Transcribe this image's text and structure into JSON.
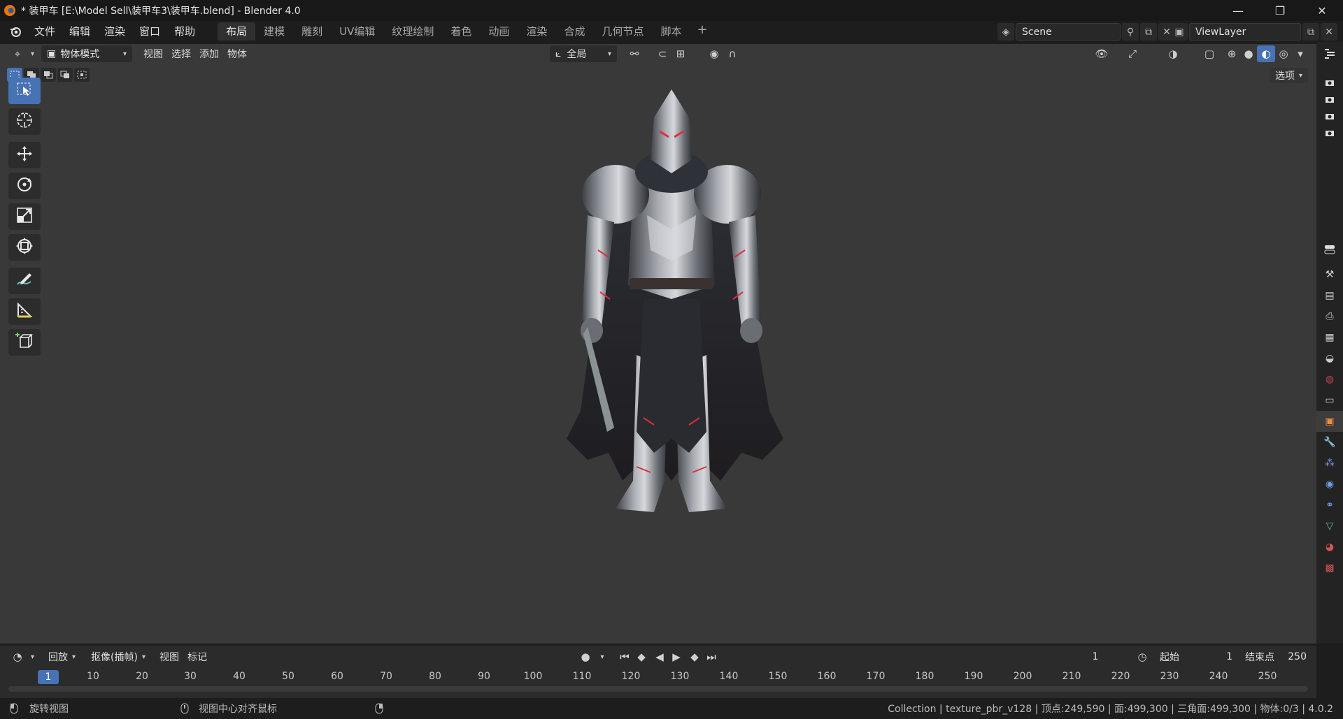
{
  "window": {
    "title": "* 装甲车 [E:\\Model Sell\\装甲车3\\装甲车.blend] - Blender 4.0",
    "minimize": "—",
    "maximize": "❐",
    "close": "✕"
  },
  "menubar": {
    "menus": [
      "文件",
      "编辑",
      "渲染",
      "窗口",
      "帮助"
    ],
    "workspaces": [
      "布局",
      "建模",
      "雕刻",
      "UV编辑",
      "纹理绘制",
      "着色",
      "动画",
      "渲染",
      "合成",
      "几何节点",
      "脚本"
    ],
    "active_workspace": "布局",
    "add_workspace": "+",
    "scene_name": "Scene",
    "view_layer": "ViewLayer"
  },
  "viewport": {
    "mode": "物体模式",
    "menus": [
      "视图",
      "选择",
      "添加",
      "物体"
    ],
    "transform_orientation": "全局",
    "options": "选项"
  },
  "toolbar": {
    "tools": [
      "select-box-icon",
      "cursor-icon",
      "move-icon",
      "rotate-icon",
      "scale-icon",
      "transform-icon",
      "annotate-icon",
      "measure-icon",
      "add-cube-icon"
    ]
  },
  "timeline": {
    "playback": "回放",
    "keying": "抠像(插帧)",
    "menus": [
      "视图",
      "标记"
    ],
    "current_frame": "1",
    "start_label": "起始",
    "start": "1",
    "end_label": "结束点",
    "end": "250",
    "ticks": [
      "10",
      "20",
      "30",
      "40",
      "50",
      "60",
      "70",
      "80",
      "90",
      "100",
      "110",
      "120",
      "130",
      "140",
      "150",
      "160",
      "170",
      "180",
      "190",
      "200",
      "210",
      "220",
      "230",
      "240",
      "250"
    ],
    "current_marker": "1"
  },
  "statusbar": {
    "left_hint": "旋转视图",
    "mid_hint": "视图中心对齐鼠标",
    "stats": "Collection | texture_pbr_v128 | 顶点:249,590 | 面:499,300 | 三角面:499,300 | 物体:0/3 | 4.0.2"
  },
  "colors": {
    "accent": "#4772b3",
    "viewport_bg": "#393939",
    "header_bg": "#1d1d1d"
  }
}
